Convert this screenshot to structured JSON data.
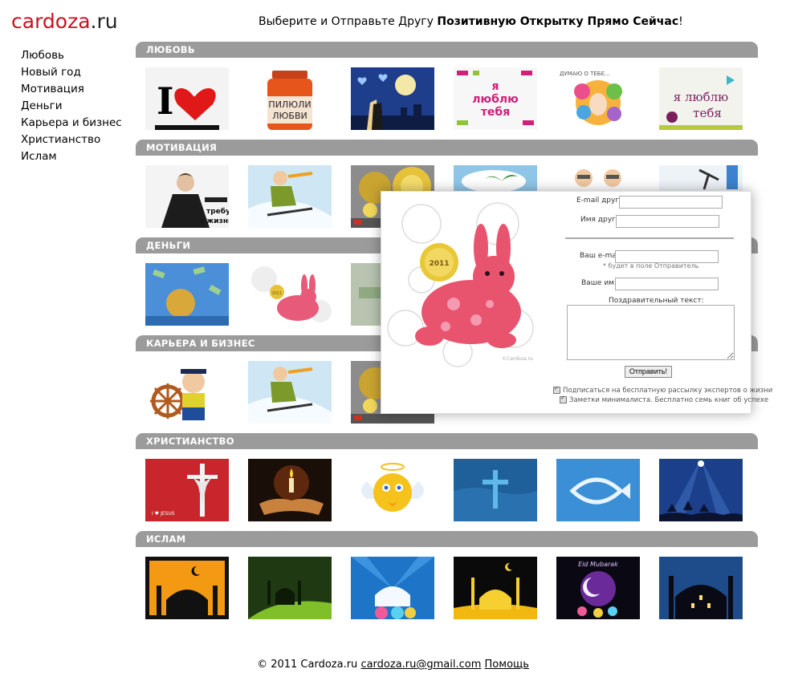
{
  "logo": {
    "part1": "cardoza",
    "part2": ".ru"
  },
  "tagline": {
    "plain": "Выберите и Отправьте Другу ",
    "bold": "Позитивную Открытку Прямо Сейчас",
    "end": "!"
  },
  "nav": [
    "Любовь",
    "Новый год",
    "Мотивация",
    "Деньги",
    "Карьера и бизнес",
    "Христианство",
    "Ислам"
  ],
  "sections": [
    {
      "title": "ЛЮБОВЬ",
      "cards": [
        "i-love-card",
        "pills-of-love-card",
        "moon-couple-card",
        "i-love-you-pink-card",
        "thinking-of-you-card",
        "i-love-you-bird-card"
      ]
    },
    {
      "title": "МОТИВАЦИЯ",
      "cards": [
        "businesswoman-card",
        "skier-card",
        "gears-coin-card",
        "island-card",
        "cartoon-men-card",
        "chart-pickaxe-card"
      ]
    },
    {
      "title": "ДЕНЬГИ",
      "cards": [
        "money-rain-card",
        "rabbit-2011-card",
        "money-hands-card",
        "card-4",
        "card-5",
        "card-6"
      ]
    },
    {
      "title": "КАРЬЕРА И БИЗНЕС",
      "cards": [
        "captain-card",
        "skier-card",
        "gears-coin-card",
        "card-4",
        "card-5",
        "card-6"
      ]
    },
    {
      "title": "ХРИСТИАНСТВО",
      "cards": [
        "crucifix-card",
        "candle-hands-card",
        "angel-smiley-card",
        "water-cross-card",
        "fish-sky-card",
        "three-kings-card"
      ]
    },
    {
      "title": "ИСЛАМ",
      "cards": [
        "mosque-orange-card",
        "mosque-green-card",
        "mosque-blue-card",
        "mosque-yellow-card",
        "eid-mubarak-card",
        "mosque-night-card"
      ]
    }
  ],
  "card_texts": {
    "i_love_letter": "I",
    "pills_label1": "ПИЛЮЛИ",
    "pills_label2": "ЛЮБВИ",
    "pink_text1": "я",
    "pink_text2": "люблю",
    "pink_text3": "тебя",
    "thinking_text": "ДУМАЮ О ТЕБЕ...",
    "bird_text1": "я люблю",
    "bird_text2": "тебя",
    "businesswoman_text1": "требу",
    "businesswoman_text2": "т жизни вс",
    "rabbit_year": "2011",
    "crucifix_caption": "I ♥ JESUS",
    "eid_text": "Eid Mubarak"
  },
  "popup": {
    "friend_email_label": "E-mail друга:",
    "friend_name_label": "Имя друга:",
    "your_email_label": "Ваш e-mail:",
    "sender_note": "* будет в поле Отправитель",
    "your_name_label": "Ваше имя:",
    "message_label": "Поздравительный текст:",
    "send_button": "Отправить!",
    "checkbox1": "Подписаться на бесплатную рассылку экспертов о жизни",
    "checkbox2": "Заметки минималиста. Бесплатно семь книг об успехе",
    "card_year": "2011",
    "watermark": "©Cardoza.ru"
  },
  "footer": {
    "copyright": "© 2011 Cardoza.ru",
    "email": "cardoza.ru@gmail.com",
    "help": "Помощь"
  },
  "colors": {
    "logo_red": "#cc1122",
    "section_bar": "#9b9b9b"
  }
}
